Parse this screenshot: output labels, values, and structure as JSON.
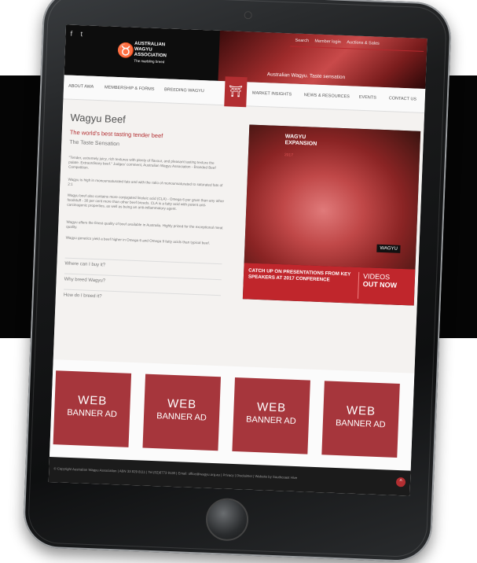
{
  "header": {
    "social": [
      "f",
      "t"
    ],
    "logo_lines": [
      "AUSTRALIAN",
      "WAGYU",
      "ASSOCIATION"
    ],
    "logo_tagline": "The marbling breed",
    "top_nav": [
      "Search",
      "Member login",
      "Auctions & Sales"
    ],
    "hero_tagline": "Australian Wagyu. Taste sensation"
  },
  "nav": {
    "items": [
      "ABOUT AWA",
      "MEMBERSHIP & FORMS",
      "BREEDING WAGYU",
      "MARKET INSIGHTS",
      "NEWS & RESOURCES",
      "EVENTS",
      "CONTACT US"
    ]
  },
  "main": {
    "title": "Wagyu Beef",
    "subtitle": "The world's best tasting tender beef",
    "section": "The Taste Sensation",
    "paragraphs": [
      "\"Tender, extremely juicy, rich textures with plenty of flavour, and pleasant tasting texture the palate. Extraordinary beef.\" Judges' comment, Australian Wagyu Association - Branded Beef Competition.",
      "Wagyu is high in monounsaturated fats and with the ratio of monounsaturated to saturated fats of 2:1",
      "Wagyu beef also contains more conjugated linoleic acid (CLA) - Omega 6 per gram than any other foodstuff - 30 per cent more than other beef breeds. CLA is a fatty acid with potent anti-carcinogenic properties, as well as being an anti-inflammatory agent.",
      "Wagyu offers the finest quality of beef available in Australia. Highly prized for the exceptional meat quality.",
      "Wagyu genetics yield a beef higher in Omega 6 and Omega 9 fatty acids than typical beef."
    ],
    "links": [
      "Where can I buy it?",
      "Why breed Wagyu?",
      "How do I breed it?"
    ]
  },
  "promo": {
    "headline": [
      "WAGYU",
      "EXPANSION"
    ],
    "subheadline": "2017",
    "badge": "WAGYU",
    "bar_text": "CATCH UP ON PRESENTATIONS FROM KEY SPEAKERS AT 2017 CONFERENCE",
    "videos": [
      "VIDEOS",
      "OUT NOW"
    ]
  },
  "banners": [
    {
      "line1": "WEB",
      "line2": "BANNER AD"
    },
    {
      "line1": "WEB",
      "line2": "BANNER AD"
    },
    {
      "line1": "WEB",
      "line2": "BANNER AD"
    },
    {
      "line1": "WEB",
      "line2": "BANNER AD"
    }
  ],
  "footer": {
    "text": "© Copyright Australian Wagyu Association | ABN 33 829 8111 | Tel (02)6773 9130 | Email: office@wagyu.org.au | Privacy | Disclaimer | Website by Southcoast Hive",
    "to_top": "^"
  },
  "colors": {
    "brand_red": "#b22e31",
    "banner_red": "#a6363c",
    "header_black": "#0d0d0d"
  }
}
